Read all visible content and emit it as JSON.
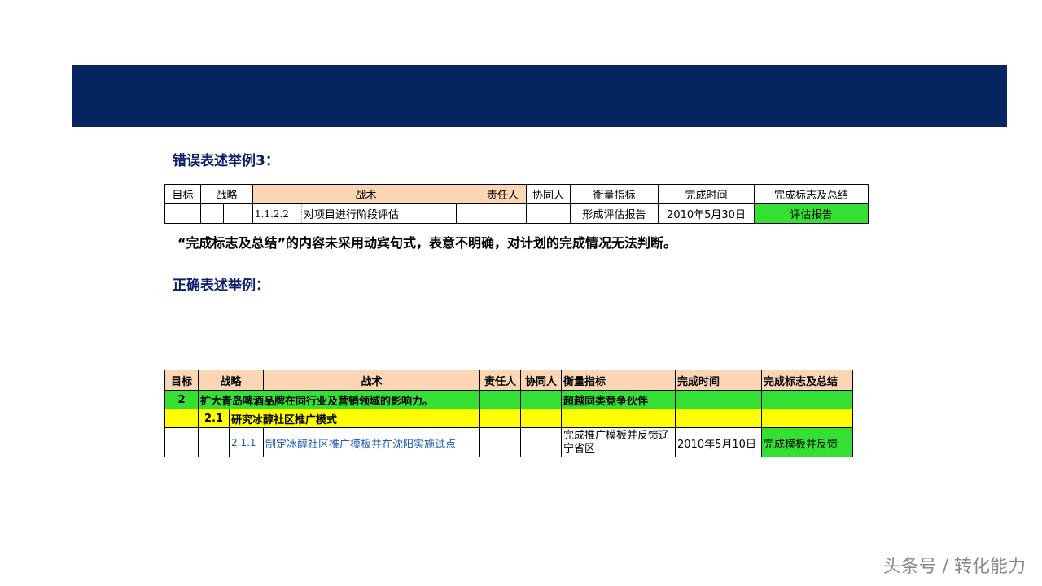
{
  "heading_wrong": "错误表述举例3：",
  "heading_right": "正确表述举例：",
  "note": "“完成标志及总结”的内容未采用动宾句式，表意不明确，对计划的完成情况无法判断。",
  "table1": {
    "headers": [
      "目标",
      "战略",
      "战术",
      "责任人",
      "协同人",
      "衡量指标",
      "完成时间",
      "完成标志及总结"
    ],
    "row": {
      "code": "1.1.2.2",
      "tactic": "对项目进行阶段评估",
      "metric": "形成评估报告",
      "time": "2010年5月30日",
      "result": "评估报告"
    }
  },
  "table2": {
    "headers": [
      "目标",
      "战略",
      "战术",
      "责任人",
      "协同人",
      "衡量指标",
      "完成时间",
      "完成标志及总结"
    ],
    "goal_row": {
      "no": "2",
      "text": "扩大青岛啤酒品牌在同行业及营销领域的影响力。",
      "metric": "超越同类竞争伙伴"
    },
    "strategy_row": {
      "no": "2.1",
      "text": "研究冰醇社区推广模式"
    },
    "tactic_row": {
      "no": "2.1.1",
      "text": "制定冰醇社区推广模板并在沈阳实施试点",
      "metric": "完成推广模板并反馈辽宁省区",
      "time": "2010年5月10日",
      "result": "完成模板并反馈"
    }
  },
  "watermark": "头条号 / 转化能力",
  "colors": {
    "banner": "#062460",
    "header_fill": "#fcd5b5",
    "green": "#33e033",
    "yellow": "#ffff00",
    "heading_text": "#0a1f6b"
  }
}
